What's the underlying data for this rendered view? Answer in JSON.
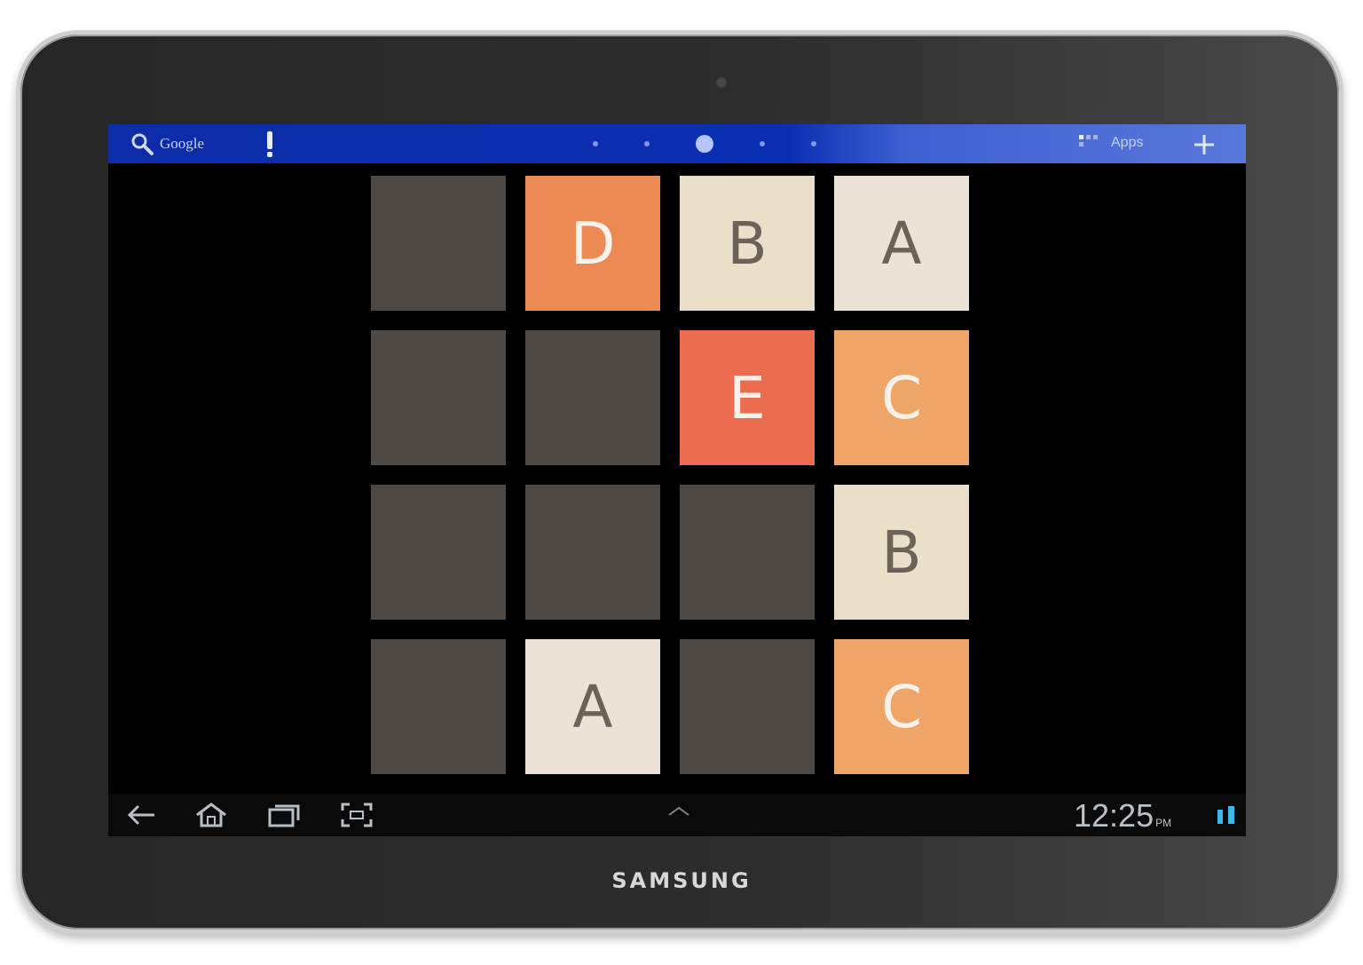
{
  "device": {
    "brand": "SAMSUNG"
  },
  "status_bar": {
    "search_label": "Google",
    "apps_label": "Apps",
    "page_count": 5,
    "active_page": 3,
    "colors": {
      "bar": "#0b2fb2"
    }
  },
  "board": {
    "rows": [
      [
        "",
        "D",
        "B",
        "A"
      ],
      [
        "",
        "",
        "E",
        "C"
      ],
      [
        "",
        "",
        "",
        "B"
      ],
      [
        "",
        "A",
        "",
        "C"
      ]
    ],
    "colors": {
      "empty": "#4e4944",
      "A": "#ece2d6",
      "B": "#eadfc8",
      "C": "#eea566",
      "D": "#ed8a54",
      "E": "#ec6c4f"
    },
    "text_colors": {
      "A": "#6c6258",
      "B": "#6c6258",
      "C": "#f8f2ea",
      "D": "#f8f2ea",
      "E": "#f8f2ea"
    }
  },
  "nav_bar": {
    "time": "12:25",
    "ampm": "PM",
    "icons": [
      "back-icon",
      "home-icon",
      "recent-apps-icon",
      "screenshot-icon"
    ]
  }
}
